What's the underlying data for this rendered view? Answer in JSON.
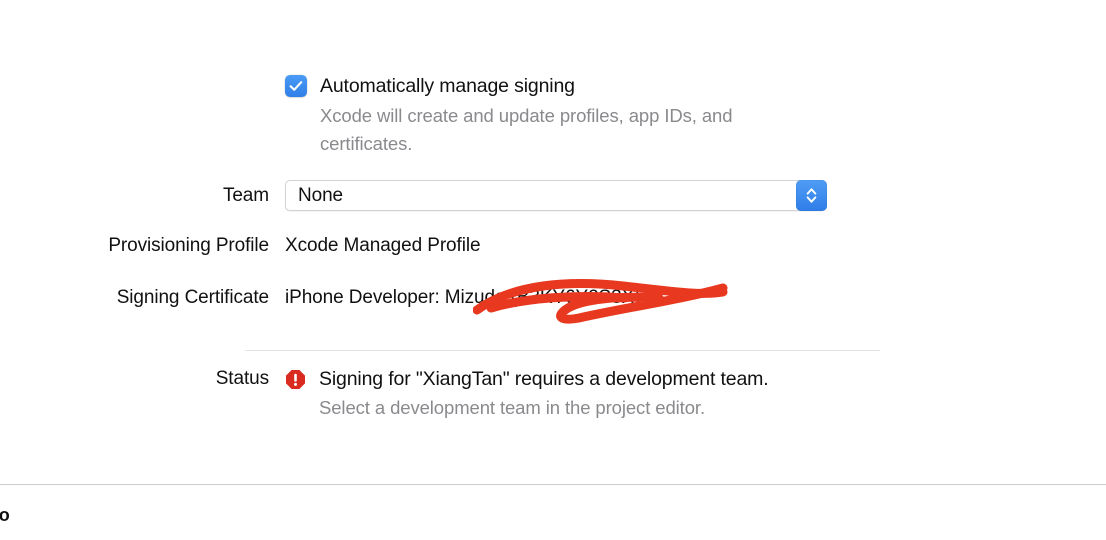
{
  "signing": {
    "auto_manage": {
      "checked": true,
      "label": "Automatically manage signing",
      "description": "Xcode will create and update profiles, app IDs, and certificates."
    },
    "team": {
      "label": "Team",
      "value": "None"
    },
    "provisioning_profile": {
      "label": "Provisioning Profile",
      "value": "Xcode Managed Profile"
    },
    "signing_certificate": {
      "label": "Signing Certificate",
      "value": "iPhone Developer: Mizuda (B3KY6Y2S3X)",
      "visible_prefix": "iPhone Developer:",
      "redacted": true
    },
    "status": {
      "label": "Status",
      "icon": "error-octagon-icon",
      "message": "Signing for \"XiangTan\" requires a development team.",
      "hint": "Select a development team in the project editor."
    }
  },
  "bottom_bar": {
    "truncated_label": "fo"
  },
  "colors": {
    "accent_blue": "#3b82f6",
    "error_red": "#d92b1f",
    "scribble_red": "#e8381f",
    "secondary_text": "#8a8a8e",
    "divider": "#e3e3e5",
    "bottom_divider": "#cccccc"
  }
}
